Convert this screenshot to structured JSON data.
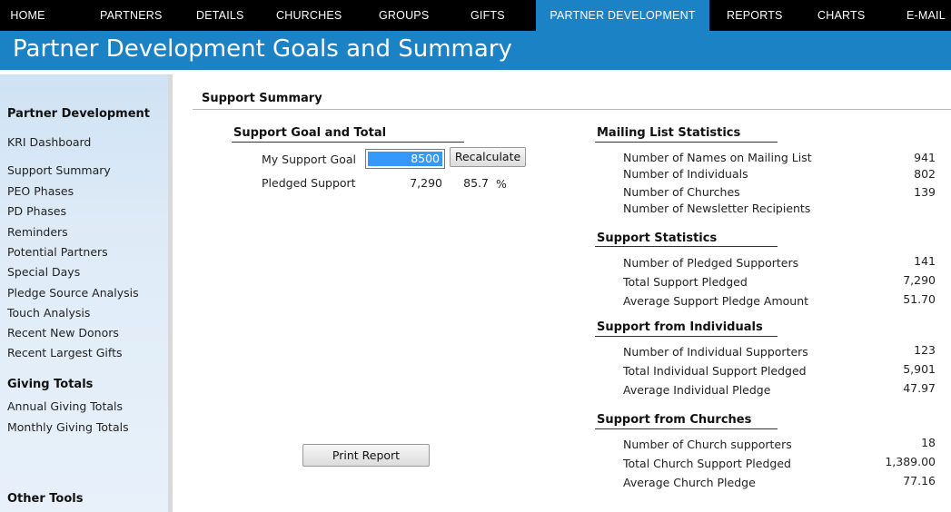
{
  "nav": {
    "items": [
      "HOME",
      "PARTNERS",
      "DETAILS",
      "CHURCHES",
      "GROUPS",
      "GIFTS",
      "PARTNER DEVELOPMENT",
      "REPORTS",
      "CHARTS",
      "E-MAIL"
    ],
    "active": "PARTNER DEVELOPMENT"
  },
  "page": {
    "title": "Partner Development Goals and Summary"
  },
  "sidebar": {
    "sections": [
      {
        "title": "Partner Development"
      },
      {
        "title": "Giving Totals"
      },
      {
        "title": "Other Tools"
      }
    ],
    "items": [
      "KRI Dashboard",
      "Support Summary",
      "PEO Phases",
      "PD Phases",
      "Reminders",
      "Potential Partners",
      "Special Days",
      "Pledge Source Analysis",
      "Touch Analysis",
      "Recent New Donors",
      "Recent Largest Gifts",
      "Annual Giving Totals",
      "Monthly Giving Totals"
    ]
  },
  "main": {
    "section_title": "Support Summary",
    "goal": {
      "title": "Support Goal and Total",
      "goal_label": "My Support Goal",
      "goal_value": "8500",
      "recalc_label": "Recalculate",
      "pledged_label": "Pledged Support",
      "pledged_value": "7,290",
      "pledged_percent": "85.7",
      "percent_sign": "%"
    },
    "print_label": "Print Report",
    "stats": [
      {
        "title": "Mailing List Statistics",
        "rows": [
          {
            "label": "Number of Names on Mailing List",
            "value": "941"
          },
          {
            "label": "Number of Individuals",
            "value": "802"
          },
          {
            "label": "Number of Churches",
            "value": "139"
          },
          {
            "label": "Number of Newsletter Recipients",
            "value": ""
          }
        ]
      },
      {
        "title": "Support Statistics",
        "rows": [
          {
            "label": "Number of Pledged Supporters",
            "value": "141"
          },
          {
            "label": "Total Support Pledged",
            "value": "7,290"
          },
          {
            "label": "Average Support Pledge Amount",
            "value": "51.70"
          }
        ]
      },
      {
        "title": "Support from Individuals",
        "rows": [
          {
            "label": "Number of Individual Supporters",
            "value": "123"
          },
          {
            "label": "Total Individual Support Pledged",
            "value": "5,901"
          },
          {
            "label": "Average Individual Pledge",
            "value": "47.97"
          }
        ]
      },
      {
        "title": "Support from Churches",
        "rows": [
          {
            "label": "Number of Church supporters",
            "value": "18"
          },
          {
            "label": "Total Church Support Pledged",
            "value": "1,389.00"
          },
          {
            "label": "Average Church Pledge",
            "value": "77.16"
          }
        ]
      }
    ]
  },
  "colors": {
    "nav_bg": "#000000",
    "accent": "#1b82c6",
    "sidebar_bg": "#deebf7",
    "selection": "#3399ff"
  }
}
